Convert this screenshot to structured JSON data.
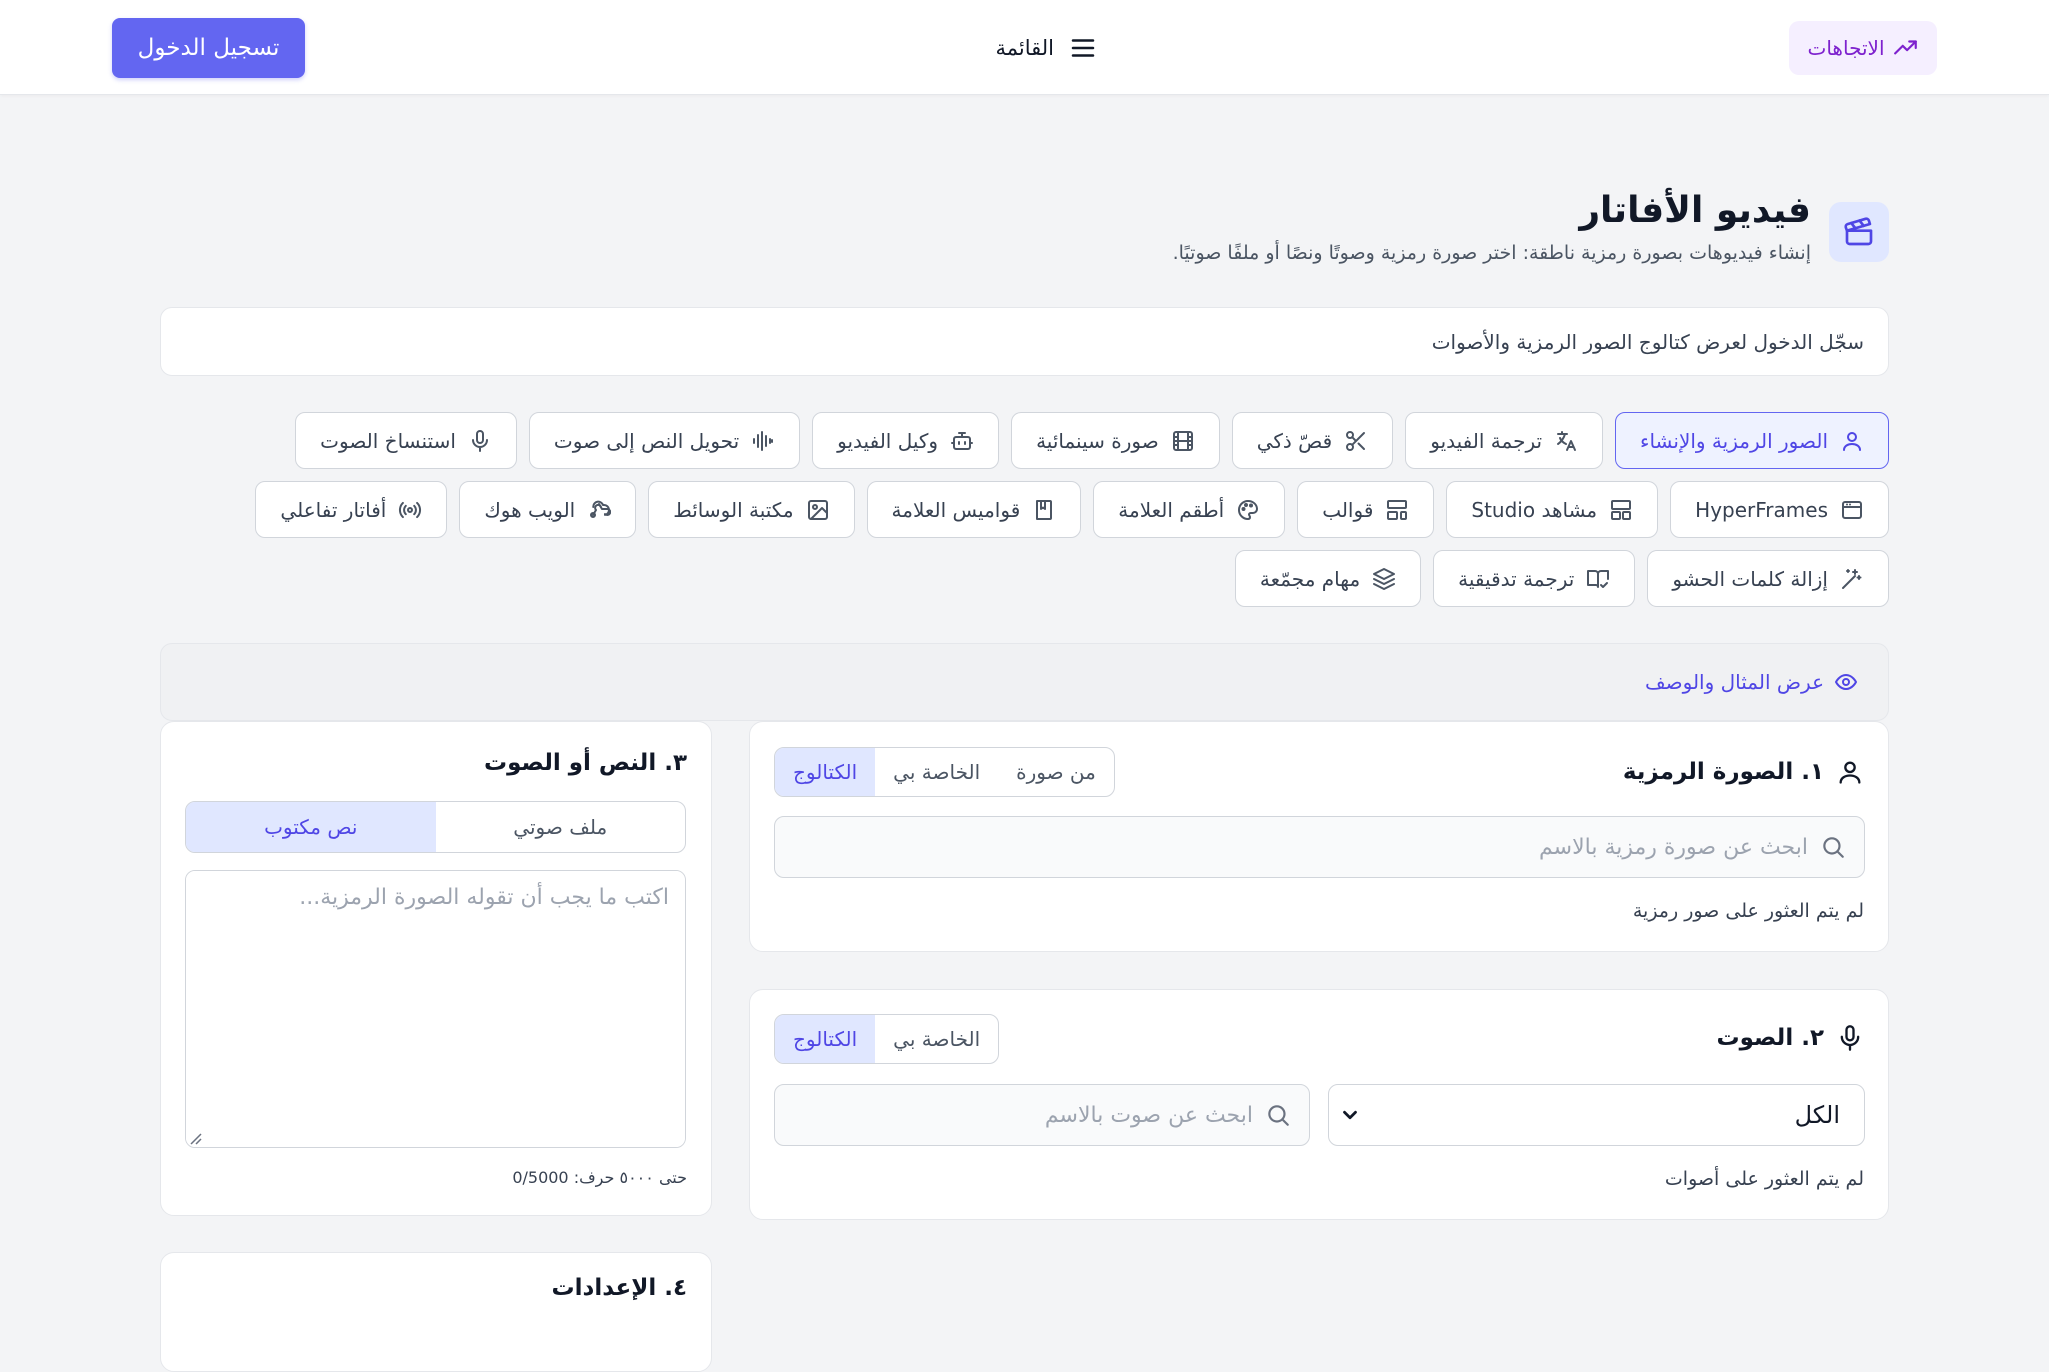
{
  "header": {
    "trends_label": "الاتجاهات",
    "menu_label": "القائمة",
    "login_label": "تسجيل الدخول"
  },
  "page": {
    "title": "فيديو الأفاتار",
    "subtitle": "إنشاء فيديوهات بصورة رمزية ناطقة: اختر صورة رمزية وصوتًا ونصًا أو ملفًا صوتيًا.",
    "notice": "سجّل الدخول لعرض كتالوج الصور الرمزية والأصوات"
  },
  "tabs": {
    "row1": [
      {
        "label": "الصور الرمزية والإنشاء",
        "icon": "user-icon",
        "active": true
      },
      {
        "label": "ترجمة الفيديو",
        "icon": "translate-icon"
      },
      {
        "label": "قصّ ذكي",
        "icon": "scissors-icon"
      },
      {
        "label": "صورة سينمائية",
        "icon": "film-icon"
      },
      {
        "label": "وكيل الفيديو",
        "icon": "bot-icon"
      },
      {
        "label": "تحويل النص إلى صوت",
        "icon": "audio-waveform-icon"
      },
      {
        "label": "استنساخ الصوت",
        "icon": "microphone-icon"
      }
    ],
    "row2": [
      {
        "label": "HyperFrames",
        "icon": "browser-window-icon"
      },
      {
        "label": "مشاهد Studio",
        "icon": "layout-icon"
      },
      {
        "label": "قوالب",
        "icon": "template-icon"
      },
      {
        "label": "أطقم العلامة",
        "icon": "palette-icon"
      },
      {
        "label": "قواميس العلامة",
        "icon": "book-icon"
      },
      {
        "label": "مكتبة الوسائط",
        "icon": "image-icon"
      },
      {
        "label": "الويب هوك",
        "icon": "webhook-icon"
      },
      {
        "label": "أفاتار تفاعلي",
        "icon": "broadcast-icon"
      }
    ],
    "row3": [
      {
        "label": "إزالة كلمات الحشو",
        "icon": "magic-wand-icon"
      },
      {
        "label": "ترجمة تدقيقية",
        "icon": "book-check-icon"
      },
      {
        "label": "مهام مجمّعة",
        "icon": "layers-icon"
      }
    ]
  },
  "example_bar": {
    "label": "عرض المثال والوصف"
  },
  "avatar_card": {
    "title": "١. الصورة الرمزية",
    "segments": [
      "الكتالوج",
      "الخاصة بي",
      "من صورة"
    ],
    "active_segment": 0,
    "search_placeholder": "ابحث عن صورة رمزية بالاسم",
    "empty_text": "لم يتم العثور على صور رمزية"
  },
  "voice_card": {
    "title": "٢. الصوت",
    "segments": [
      "الكتالوج",
      "الخاصة بي"
    ],
    "active_segment": 0,
    "filter_value": "الكل",
    "search_placeholder": "ابحث عن صوت بالاسم",
    "empty_text": "لم يتم العثور على أصوات"
  },
  "text_card": {
    "title": "٣. النص أو الصوت",
    "segments": [
      "نص مكتوب",
      "ملف صوتي"
    ],
    "active_segment": 0,
    "textarea_placeholder": "اكتب ما يجب أن تقوله الصورة الرمزية...",
    "char_count": "حتى ٥٠٠٠ حرف: 0/5000"
  },
  "settings_card": {
    "title": "٤. الإعدادات"
  },
  "colors": {
    "accent": "#6366f1",
    "accent_text": "#4f46e5",
    "trends": "#7e22ce"
  }
}
